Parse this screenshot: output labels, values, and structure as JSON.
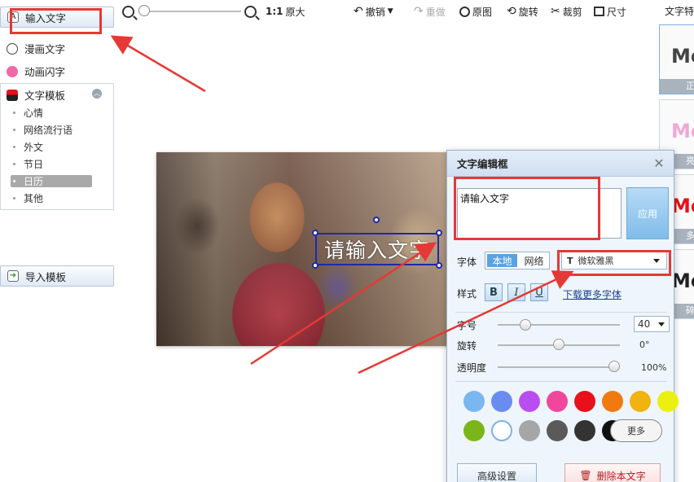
{
  "toolbar": {
    "zoom_ratio": "1:1",
    "original_size": "原大",
    "undo": "撤销",
    "redo": "重做",
    "original_image": "原图",
    "rotate": "旋转",
    "crop": "裁剪",
    "size": "尺寸"
  },
  "left_panel": {
    "input_text": "输入文字",
    "comic_text": "漫画文字",
    "animated_text": "动画闪字",
    "text_templates": "文字模板",
    "templates": [
      "心情",
      "网络流行语",
      "外文",
      "节日",
      "日历",
      "其他"
    ],
    "selected_template": "日历",
    "import_template": "导入模板"
  },
  "canvas": {
    "overlay_text": "请输入文字"
  },
  "right_strip": {
    "title": "文字特",
    "thumbs": [
      {
        "sample": "Me",
        "label": "正"
      },
      {
        "sample": "Me",
        "label": "亮"
      },
      {
        "sample": "Me",
        "label": "多"
      },
      {
        "sample": "Me",
        "label": "碎"
      }
    ]
  },
  "dialog": {
    "title": "文字编辑框",
    "text_value": "请输入文字",
    "apply": "应用",
    "font_label": "字体",
    "local": "本地",
    "network": "网络",
    "font_name": "微软雅黑",
    "style_label": "样式",
    "bold": "B",
    "italic": "I",
    "underline": "U",
    "download_fonts": "下载更多字体",
    "size_label": "字号",
    "size_value": "40",
    "rotate_label": "旋转",
    "rotate_value": "0°",
    "opacity_label": "透明度",
    "opacity_value": "100%",
    "size_slider_level": 0.2,
    "rotate_slider_level": 0.5,
    "opacity_slider_level": 1.0,
    "more_colors": "更多",
    "advanced": "高级设置",
    "delete_text": "删除本文字",
    "colors_row1": [
      "#7ab6f0",
      "#6a8cf0",
      "#b94ef0",
      "#f0479c",
      "#e8101a",
      "#f07a10",
      "#f0b410",
      "#ecf010"
    ],
    "colors_row2": [
      "#7ab61a",
      "#ffffff",
      "#a6a6a6",
      "#5a5a5a",
      "#333333",
      "#111111"
    ]
  },
  "accent": "#5aa3e0",
  "annotation_color": "#e53935"
}
